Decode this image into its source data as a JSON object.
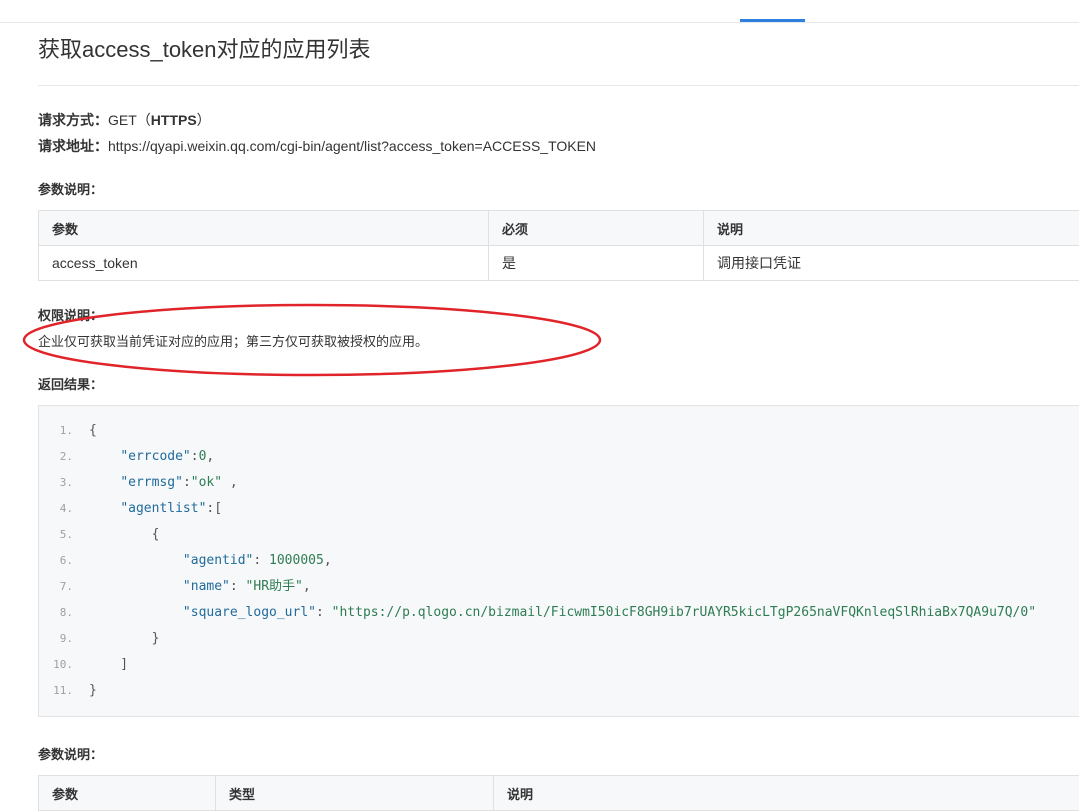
{
  "title": "获取access_token对应的应用列表",
  "request": {
    "method_label": "请求方式：",
    "method_value": "GET（",
    "method_proto": "HTTPS",
    "method_close": "）",
    "url_label": "请求地址：",
    "url_value": "https://qyapi.weixin.qq.com/cgi-bin/agent/list?access_token=ACCESS_TOKEN"
  },
  "params_heading": "参数说明：",
  "params_table": {
    "headers": [
      "参数",
      "必须",
      "说明"
    ],
    "rows": [
      [
        "access_token",
        "是",
        "调用接口凭证"
      ]
    ]
  },
  "permission": {
    "heading": "权限说明：",
    "text": "企业仅可获取当前凭证对应的应用；第三方仅可获取被授权的应用。"
  },
  "result_heading": "返回结果：",
  "code": {
    "lines": [
      {
        "n": "1.",
        "parts": [
          [
            "p",
            "{"
          ]
        ]
      },
      {
        "n": "2.",
        "parts": [
          [
            "p",
            "    "
          ],
          [
            "k",
            "\"errcode\""
          ],
          [
            "p",
            ":"
          ],
          [
            "n",
            "0"
          ],
          [
            "p",
            ","
          ]
        ]
      },
      {
        "n": "3.",
        "parts": [
          [
            "p",
            "    "
          ],
          [
            "k",
            "\"errmsg\""
          ],
          [
            "p",
            ":"
          ],
          [
            "s",
            "\"ok\""
          ],
          [
            "p",
            " ,"
          ]
        ]
      },
      {
        "n": "4.",
        "parts": [
          [
            "p",
            "    "
          ],
          [
            "k",
            "\"agentlist\""
          ],
          [
            "p",
            ":["
          ]
        ]
      },
      {
        "n": "5.",
        "parts": [
          [
            "p",
            "        {"
          ]
        ]
      },
      {
        "n": "6.",
        "parts": [
          [
            "p",
            "            "
          ],
          [
            "k",
            "\"agentid\""
          ],
          [
            "p",
            ": "
          ],
          [
            "n",
            "1000005"
          ],
          [
            "p",
            ","
          ]
        ]
      },
      {
        "n": "7.",
        "parts": [
          [
            "p",
            "            "
          ],
          [
            "k",
            "\"name\""
          ],
          [
            "p",
            ": "
          ],
          [
            "s",
            "\"HR助手\""
          ],
          [
            "p",
            ","
          ]
        ]
      },
      {
        "n": "8.",
        "parts": [
          [
            "p",
            "            "
          ],
          [
            "k",
            "\"square_logo_url\""
          ],
          [
            "p",
            ": "
          ],
          [
            "s",
            "\"https://p.qlogo.cn/bizmail/FicwmI50icF8GH9ib7rUAYR5kicLTgP265naVFQKnleqSlRhiaBx7QA9u7Q/0\""
          ]
        ]
      },
      {
        "n": "9.",
        "parts": [
          [
            "p",
            "        }"
          ]
        ]
      },
      {
        "n": "10.",
        "parts": [
          [
            "p",
            "    ]"
          ]
        ]
      },
      {
        "n": "11.",
        "parts": [
          [
            "p",
            "}"
          ]
        ]
      }
    ]
  },
  "params_heading_2": "参数说明：",
  "params_table_2": {
    "headers": [
      "参数",
      "类型",
      "说明"
    ]
  },
  "colors": {
    "accent": "#2f7fe0",
    "annotation": "#e0242a"
  }
}
